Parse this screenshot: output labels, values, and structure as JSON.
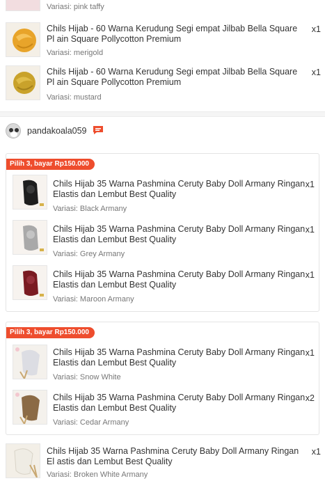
{
  "top_items": [
    {
      "variant": "Variasi: pink taffy"
    },
    {
      "name": "Chils Hijab - 60 Warna Kerudung Segi empat Jilbab Bella Square Pl ain Square Pollycotton Premium",
      "qty": "x1",
      "variant": "Variasi: merigold",
      "color": "#e8a42a"
    },
    {
      "name": "Chils Hijab - 60 Warna Kerudung Segi empat Jilbab Bella Square Pl ain Square Pollycotton Premium",
      "qty": "x1",
      "variant": "Variasi: mustard",
      "color": "#c9a22b"
    }
  ],
  "shop": {
    "name": "pandakoala059"
  },
  "bundle1": {
    "badge": "Pilih 3, bayar Rp150.000",
    "items": [
      {
        "name": "Chils Hijab 35 Warna Pashmina Ceruty Baby Doll Armany Ringan Elastis dan Lembut Best Quality",
        "qty": "x1",
        "variant": "Variasi: Black Armany",
        "color": "#1e1e1e"
      },
      {
        "name": "Chils Hijab 35 Warna Pashmina Ceruty Baby Doll Armany Ringan Elastis dan Lembut Best Quality",
        "qty": "x1",
        "variant": "Variasi: Grey Armany",
        "color": "#a9a9a9"
      },
      {
        "name": "Chils Hijab 35 Warna Pashmina Ceruty Baby Doll Armany Ringan Elastis dan Lembut Best Quality",
        "qty": "x1",
        "variant": "Variasi: Maroon Armany",
        "color": "#7a1b22"
      }
    ]
  },
  "bundle2": {
    "badge": "Pilih 3, bayar Rp150.000",
    "items": [
      {
        "name": "Chils Hijab 35 Warna Pashmina Ceruty Baby Doll Armany Ringan Elastis dan Lembut Best Quality",
        "qty": "x1",
        "variant": "Variasi: Snow White",
        "color": "#dcdde3"
      },
      {
        "name": "Chils Hijab 35 Warna Pashmina Ceruty Baby Doll Armany Ringan Elastis dan Lembut Best Quality",
        "qty": "x2",
        "variant": "Variasi: Cedar Armany",
        "color": "#8b6a45"
      }
    ]
  },
  "last_item": {
    "name": "Chils Hijab 35 Warna Pashmina Ceruty Baby Doll Armany Ringan El astis dan Lembut Best Quality",
    "qty": "x1",
    "variant": "Variasi: Broken White Armany",
    "color": "#efece4"
  },
  "colors": {
    "accent": "#ee4d2d"
  },
  "icons": {
    "chat": "chat-icon"
  }
}
